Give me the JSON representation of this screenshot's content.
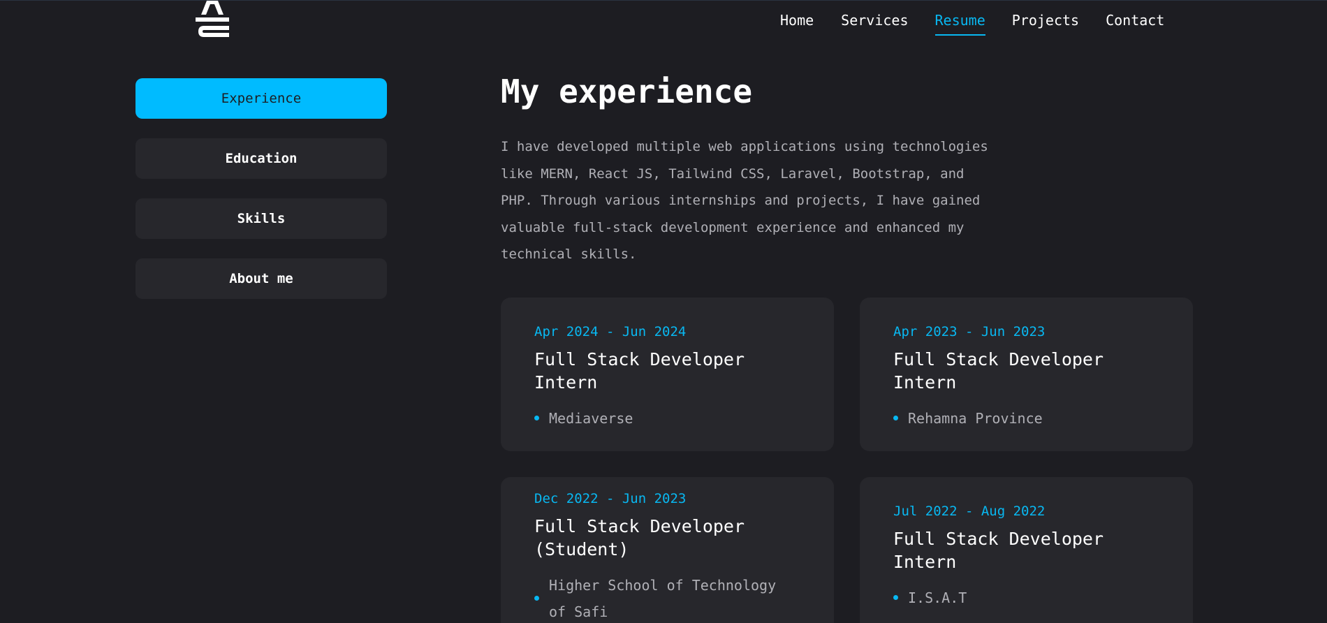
{
  "header": {
    "logo_text": "AE",
    "nav": [
      {
        "label": "Home",
        "active": false
      },
      {
        "label": "Services",
        "active": false
      },
      {
        "label": "Resume",
        "active": true
      },
      {
        "label": "Projects",
        "active": false
      },
      {
        "label": "Contact",
        "active": false
      }
    ]
  },
  "sidebar": {
    "items": [
      {
        "label": "Experience",
        "active": true
      },
      {
        "label": "Education",
        "active": false
      },
      {
        "label": "Skills",
        "active": false
      },
      {
        "label": "About me",
        "active": false
      }
    ]
  },
  "main": {
    "title": "My experience",
    "description": "I have developed multiple web applications using technologies like MERN, React JS, Tailwind CSS, Laravel, Bootstrap, and PHP. Through various internships and projects, I have gained valuable full-stack development experience and enhanced my technical skills.",
    "experiences": [
      {
        "period": "Apr 2024 - Jun 2024",
        "role": "Full Stack Developer Intern",
        "company": "Mediaverse"
      },
      {
        "period": "Apr 2023 - Jun 2023",
        "role": "Full Stack Developer Intern",
        "company": "Rehamna Province"
      },
      {
        "period": "Dec 2022 - Jun 2023",
        "role": "Full Stack Developer (Student)",
        "company": "Higher School of Technology of Safi"
      },
      {
        "period": "Jul 2022 - Aug 2022",
        "role": "Full Stack Developer Intern",
        "company": "I.S.A.T"
      }
    ]
  },
  "colors": {
    "accent": "#08b8f2",
    "background": "#1d1d22",
    "card": "#27272c"
  }
}
